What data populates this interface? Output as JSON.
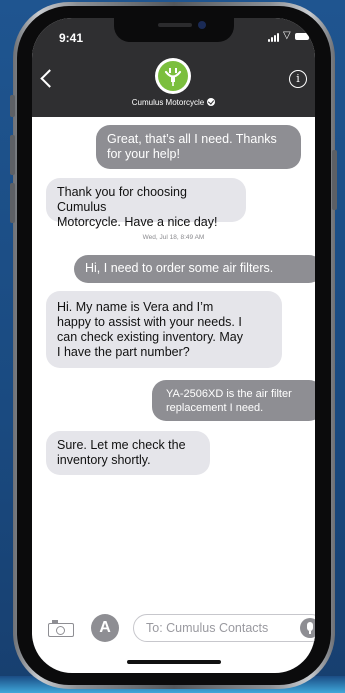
{
  "status_bar": {
    "time": "9:41"
  },
  "header": {
    "contact_name": "Cumulus Motorcycle",
    "logo_icon": "plug-leaf-logo",
    "back_icon": "chevron-left-icon",
    "info_icon": "info-icon",
    "info_glyph": "i",
    "brand_color": "#7bbf3d"
  },
  "conversation": {
    "messages": [
      {
        "from": "user",
        "lines": [
          "Great, that’s all I need. Thanks",
          "for your help!"
        ]
      },
      {
        "from": "business",
        "lines": [
          "Thank you for choosing Cumulus",
          "Motorcycle. Have a nice day!"
        ]
      },
      {
        "from": "user",
        "lines": [
          "Hi, I need to order some air filters."
        ]
      },
      {
        "from": "business",
        "lines": [
          "Hi. My name is Vera and I’m",
          "happy to assist with your needs. I",
          "can check existing inventory. May",
          "I have the part number?"
        ]
      },
      {
        "from": "user",
        "lines": [
          "YA-2506XD  is the air filter",
          "replacement I need."
        ]
      },
      {
        "from": "business",
        "lines": [
          "Sure. Let me check the",
          "inventory shortly."
        ]
      }
    ],
    "timestamp": "Wed, Jul 18, 8:49 AM"
  },
  "input_bar": {
    "placeholder": "To: Cumulus Contacts",
    "camera_icon": "camera-icon",
    "appstore_icon": "app-store-icon",
    "appstore_glyph": "A",
    "mic_icon": "microphone-icon"
  }
}
